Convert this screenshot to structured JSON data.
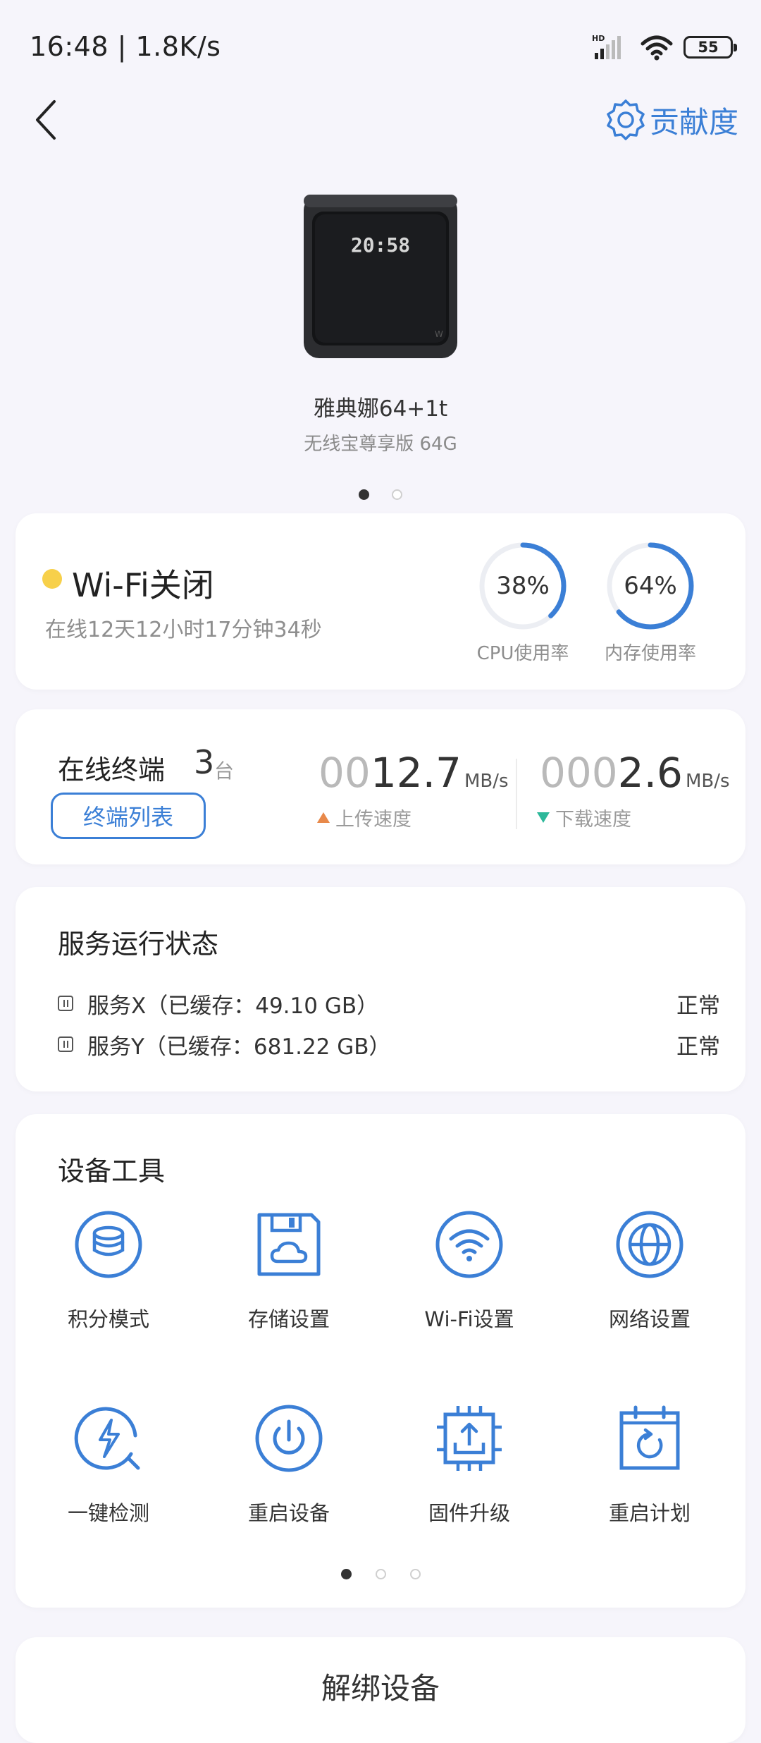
{
  "status_bar": {
    "time": "16:48 | 1.8K/s",
    "network": "HD",
    "battery": "55"
  },
  "nav": {
    "contribution_label": "贡献度"
  },
  "device": {
    "screen_time": "20:58",
    "name": "雅典娜64+1t",
    "model": "无线宝尊享版 64G"
  },
  "status_card": {
    "wifi_status": "Wi-Fi关闭",
    "uptime": "在线12天12小时17分钟34秒",
    "cpu": {
      "value": "38%",
      "label": "CPU使用率",
      "fraction": 0.38
    },
    "memory": {
      "value": "64%",
      "label": "内存使用率",
      "fraction": 0.64
    }
  },
  "terminal_card": {
    "label": "在线终端",
    "count": "3",
    "unit": "台",
    "list_button": "终端列表",
    "upload": {
      "prefix": "00",
      "value": "12.7",
      "unit": "MB/s",
      "label": "上传速度"
    },
    "download": {
      "prefix": "000",
      "value": "2.6",
      "unit": "MB/s",
      "label": "下载速度"
    }
  },
  "service_card": {
    "title": "服务运行状态",
    "services": [
      {
        "name": "服务X（已缓存：49.10 GB）",
        "state": "正常"
      },
      {
        "name": "服务Y（已缓存：681.22 GB）",
        "state": "正常"
      }
    ]
  },
  "tools_card": {
    "title": "设备工具",
    "tools": [
      {
        "label": "积分模式",
        "icon": "coins-icon"
      },
      {
        "label": "存储设置",
        "icon": "storage-icon"
      },
      {
        "label": "Wi-Fi设置",
        "icon": "wifi-icon"
      },
      {
        "label": "网络设置",
        "icon": "globe-icon"
      },
      {
        "label": "一键检测",
        "icon": "detect-icon"
      },
      {
        "label": "重启设备",
        "icon": "power-icon"
      },
      {
        "label": "固件升级",
        "icon": "firmware-icon"
      },
      {
        "label": "重启计划",
        "icon": "schedule-icon"
      }
    ]
  },
  "unbind_label": "解绑设备",
  "colors": {
    "accent": "#3b7fd6",
    "wifi_dot": "#f7d04a",
    "upload": "#e8894a",
    "download": "#2db89a"
  }
}
